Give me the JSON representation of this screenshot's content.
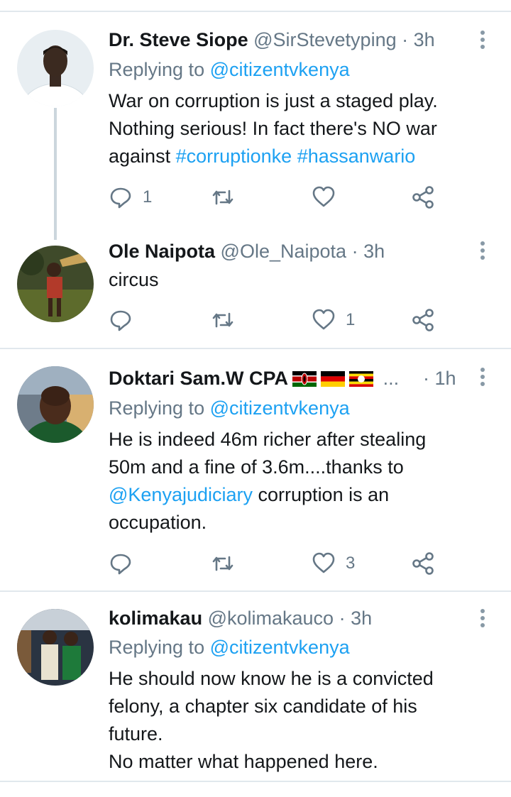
{
  "tweets": [
    {
      "name": "Dr. Steve Siope",
      "handle": "@SirStevetyping",
      "time": "· 3h",
      "replying_prefix": "Replying to",
      "replying_to": "@citizentvkenya",
      "body_lines": [
        "War on corruption is just a staged play.",
        "Nothing serious! In fact there's NO war"
      ],
      "body_line3_text": "against",
      "hashtags": [
        "#corruptionke",
        "#hassanwario"
      ],
      "reply_count": "1",
      "retweet_count": "",
      "like_count": ""
    },
    {
      "name": "Ole Naipota",
      "handle": "@Ole_Naipota",
      "time": "· 3h",
      "body": "circus",
      "reply_count": "",
      "retweet_count": "",
      "like_count": "1"
    },
    {
      "name": "Doktari Sam.W CPA",
      "name_ellipsis": "...",
      "time": "· 1h",
      "replying_prefix": "Replying to",
      "replying_to": "@citizentvkenya",
      "body_lines": [
        "He is indeed 46m richer after stealing",
        "50m and a fine of 3.6m....thanks to"
      ],
      "mention": "@Kenyajudiciary",
      "body_line3_rest": "corruption is an",
      "body_line4": "occupation.",
      "reply_count": "",
      "retweet_count": "",
      "like_count": "3",
      "flags": [
        "kenya-flag",
        "germany-flag",
        "uganda-flag"
      ]
    },
    {
      "name": "kolimakau",
      "handle": "@kolimakauco",
      "time": "· 3h",
      "replying_prefix": "Replying to",
      "replying_to": "@citizentvkenya",
      "body_lines": [
        "He should now know he is a convicted",
        "felony, a chapter six candidate of his",
        "future.",
        "No matter what happened here."
      ]
    }
  ],
  "icons": [
    "reply-icon",
    "retweet-icon",
    "like-icon",
    "share-icon",
    "more-icon"
  ],
  "colors": {
    "link": "#1da1f2",
    "meta": "#657786",
    "divider": "#e1e8ed"
  }
}
